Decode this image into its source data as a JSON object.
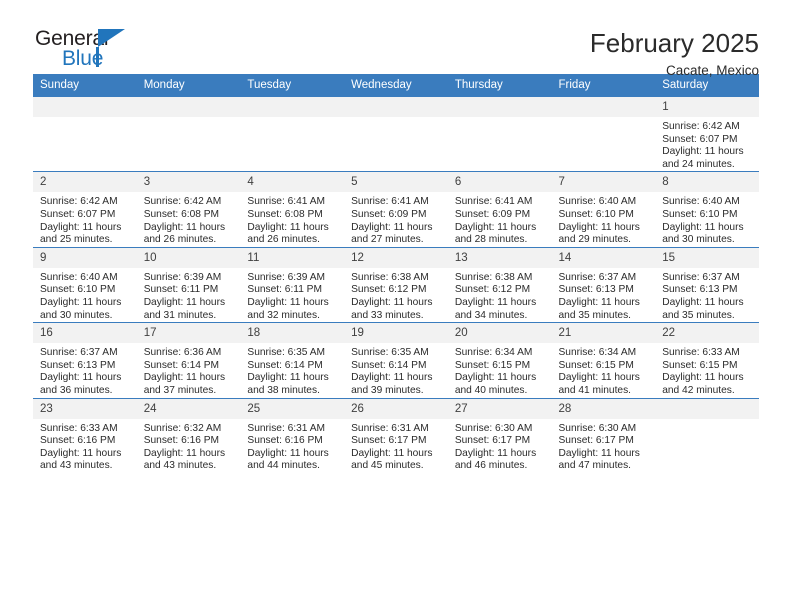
{
  "brand": {
    "name_part1": "General",
    "name_part2": "Blue",
    "triangle_color": "#2175bc",
    "text_color": "#231f20"
  },
  "header": {
    "title": "February 2025",
    "subtitle": "Cacate, Mexico"
  },
  "colors": {
    "header_row_bg": "#3a7cbe",
    "header_row_text": "#ffffff",
    "daynum_bg": "#f2f2f2",
    "cell_text": "#2b2b2b",
    "row_divider": "#3a7cbe"
  },
  "calendar": {
    "weekday_headers": [
      "Sunday",
      "Monday",
      "Tuesday",
      "Wednesday",
      "Thursday",
      "Friday",
      "Saturday"
    ],
    "labels": {
      "sunrise": "Sunrise:",
      "sunset": "Sunset:",
      "daylight": "Daylight:"
    },
    "weeks": [
      [
        {
          "day": "",
          "empty": true
        },
        {
          "day": "",
          "empty": true
        },
        {
          "day": "",
          "empty": true
        },
        {
          "day": "",
          "empty": true
        },
        {
          "day": "",
          "empty": true
        },
        {
          "day": "",
          "empty": true
        },
        {
          "day": "1",
          "sunrise": "Sunrise: 6:42 AM",
          "sunset": "Sunset: 6:07 PM",
          "daylight": "Daylight: 11 hours and 24 minutes."
        }
      ],
      [
        {
          "day": "2",
          "sunrise": "Sunrise: 6:42 AM",
          "sunset": "Sunset: 6:07 PM",
          "daylight": "Daylight: 11 hours and 25 minutes."
        },
        {
          "day": "3",
          "sunrise": "Sunrise: 6:42 AM",
          "sunset": "Sunset: 6:08 PM",
          "daylight": "Daylight: 11 hours and 26 minutes."
        },
        {
          "day": "4",
          "sunrise": "Sunrise: 6:41 AM",
          "sunset": "Sunset: 6:08 PM",
          "daylight": "Daylight: 11 hours and 26 minutes."
        },
        {
          "day": "5",
          "sunrise": "Sunrise: 6:41 AM",
          "sunset": "Sunset: 6:09 PM",
          "daylight": "Daylight: 11 hours and 27 minutes."
        },
        {
          "day": "6",
          "sunrise": "Sunrise: 6:41 AM",
          "sunset": "Sunset: 6:09 PM",
          "daylight": "Daylight: 11 hours and 28 minutes."
        },
        {
          "day": "7",
          "sunrise": "Sunrise: 6:40 AM",
          "sunset": "Sunset: 6:10 PM",
          "daylight": "Daylight: 11 hours and 29 minutes."
        },
        {
          "day": "8",
          "sunrise": "Sunrise: 6:40 AM",
          "sunset": "Sunset: 6:10 PM",
          "daylight": "Daylight: 11 hours and 30 minutes."
        }
      ],
      [
        {
          "day": "9",
          "sunrise": "Sunrise: 6:40 AM",
          "sunset": "Sunset: 6:10 PM",
          "daylight": "Daylight: 11 hours and 30 minutes."
        },
        {
          "day": "10",
          "sunrise": "Sunrise: 6:39 AM",
          "sunset": "Sunset: 6:11 PM",
          "daylight": "Daylight: 11 hours and 31 minutes."
        },
        {
          "day": "11",
          "sunrise": "Sunrise: 6:39 AM",
          "sunset": "Sunset: 6:11 PM",
          "daylight": "Daylight: 11 hours and 32 minutes."
        },
        {
          "day": "12",
          "sunrise": "Sunrise: 6:38 AM",
          "sunset": "Sunset: 6:12 PM",
          "daylight": "Daylight: 11 hours and 33 minutes."
        },
        {
          "day": "13",
          "sunrise": "Sunrise: 6:38 AM",
          "sunset": "Sunset: 6:12 PM",
          "daylight": "Daylight: 11 hours and 34 minutes."
        },
        {
          "day": "14",
          "sunrise": "Sunrise: 6:37 AM",
          "sunset": "Sunset: 6:13 PM",
          "daylight": "Daylight: 11 hours and 35 minutes."
        },
        {
          "day": "15",
          "sunrise": "Sunrise: 6:37 AM",
          "sunset": "Sunset: 6:13 PM",
          "daylight": "Daylight: 11 hours and 35 minutes."
        }
      ],
      [
        {
          "day": "16",
          "sunrise": "Sunrise: 6:37 AM",
          "sunset": "Sunset: 6:13 PM",
          "daylight": "Daylight: 11 hours and 36 minutes."
        },
        {
          "day": "17",
          "sunrise": "Sunrise: 6:36 AM",
          "sunset": "Sunset: 6:14 PM",
          "daylight": "Daylight: 11 hours and 37 minutes."
        },
        {
          "day": "18",
          "sunrise": "Sunrise: 6:35 AM",
          "sunset": "Sunset: 6:14 PM",
          "daylight": "Daylight: 11 hours and 38 minutes."
        },
        {
          "day": "19",
          "sunrise": "Sunrise: 6:35 AM",
          "sunset": "Sunset: 6:14 PM",
          "daylight": "Daylight: 11 hours and 39 minutes."
        },
        {
          "day": "20",
          "sunrise": "Sunrise: 6:34 AM",
          "sunset": "Sunset: 6:15 PM",
          "daylight": "Daylight: 11 hours and 40 minutes."
        },
        {
          "day": "21",
          "sunrise": "Sunrise: 6:34 AM",
          "sunset": "Sunset: 6:15 PM",
          "daylight": "Daylight: 11 hours and 41 minutes."
        },
        {
          "day": "22",
          "sunrise": "Sunrise: 6:33 AM",
          "sunset": "Sunset: 6:15 PM",
          "daylight": "Daylight: 11 hours and 42 minutes."
        }
      ],
      [
        {
          "day": "23",
          "sunrise": "Sunrise: 6:33 AM",
          "sunset": "Sunset: 6:16 PM",
          "daylight": "Daylight: 11 hours and 43 minutes."
        },
        {
          "day": "24",
          "sunrise": "Sunrise: 6:32 AM",
          "sunset": "Sunset: 6:16 PM",
          "daylight": "Daylight: 11 hours and 43 minutes."
        },
        {
          "day": "25",
          "sunrise": "Sunrise: 6:31 AM",
          "sunset": "Sunset: 6:16 PM",
          "daylight": "Daylight: 11 hours and 44 minutes."
        },
        {
          "day": "26",
          "sunrise": "Sunrise: 6:31 AM",
          "sunset": "Sunset: 6:17 PM",
          "daylight": "Daylight: 11 hours and 45 minutes."
        },
        {
          "day": "27",
          "sunrise": "Sunrise: 6:30 AM",
          "sunset": "Sunset: 6:17 PM",
          "daylight": "Daylight: 11 hours and 46 minutes."
        },
        {
          "day": "28",
          "sunrise": "Sunrise: 6:30 AM",
          "sunset": "Sunset: 6:17 PM",
          "daylight": "Daylight: 11 hours and 47 minutes."
        },
        {
          "day": "",
          "empty": true
        }
      ]
    ]
  }
}
